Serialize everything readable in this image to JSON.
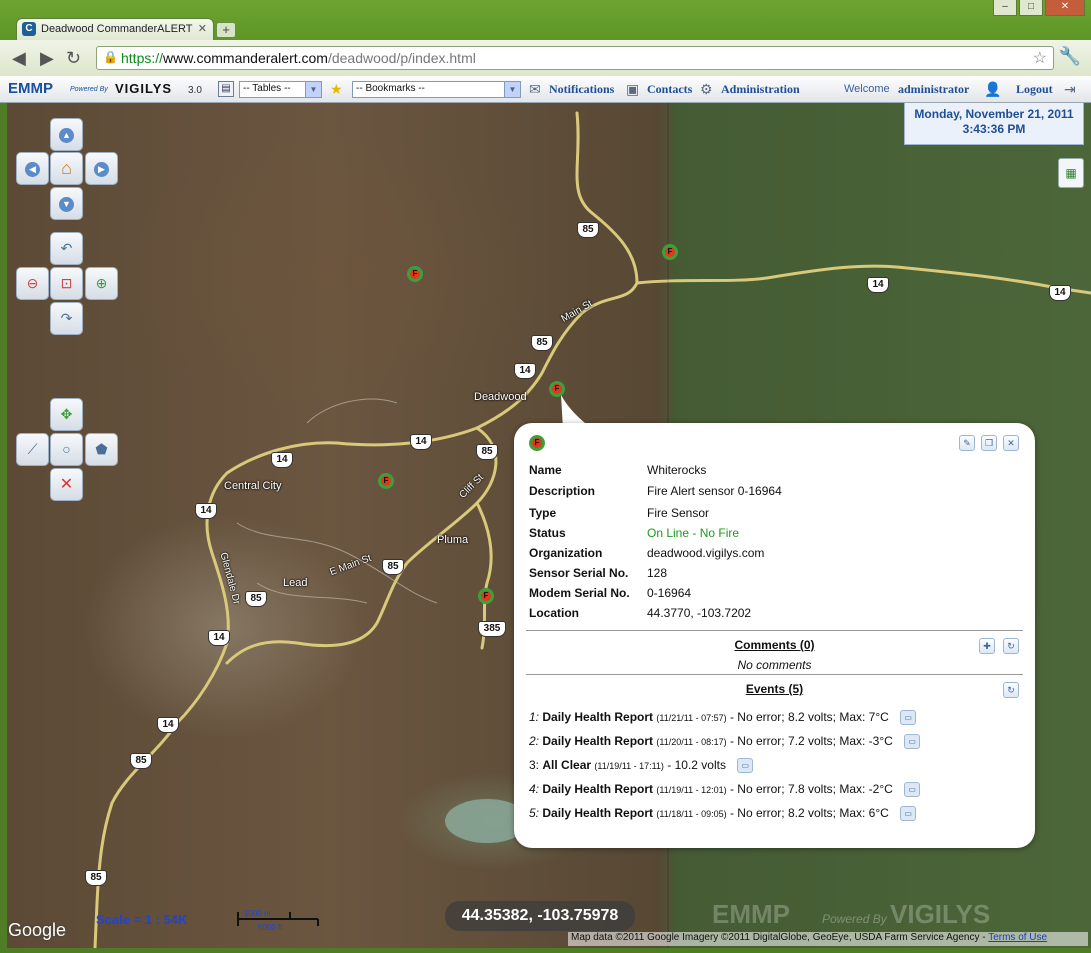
{
  "browser": {
    "tab_title": "Deadwood CommanderALERT",
    "url_scheme": "https://",
    "url_host": "www.commanderalert.com",
    "url_path": "/deadwood/p/index.html"
  },
  "toolbar": {
    "logo": "EMMP",
    "logo_powered": "Powered By",
    "logo_brand": "VIGILYS",
    "version": "3.0",
    "tables_select": "-- Tables --",
    "bookmarks_select": "-- Bookmarks --",
    "notifications": "Notifications",
    "contacts": "Contacts",
    "administration": "Administration",
    "welcome": "Welcome",
    "user": "administrator",
    "logout": "Logout"
  },
  "datetime": {
    "date": "Monday, November 21, 2011",
    "time": "3:43:36 PM"
  },
  "map": {
    "labels": {
      "deadwood": "Deadwood",
      "central_city": "Central City",
      "lead": "Lead",
      "pluma": "Pluma",
      "main_st": "Main St",
      "e_main_st": "E Main St",
      "cliff_st": "Cliff St",
      "glendale_dr": "Glendale Dr"
    },
    "shields": {
      "s85a": "85",
      "s85b": "85",
      "s85c": "85",
      "s85d": "85",
      "s85e": "85",
      "s85f": "85",
      "s85g": "85",
      "s14a": "14",
      "s14b": "14",
      "s14c": "14",
      "s14d": "14",
      "s14e": "14",
      "s14f": "14",
      "s14g": "14",
      "s14h": "14",
      "s385": "385"
    },
    "sensor_glyph": "F",
    "scale": "Scale = 1 : 54K",
    "scale_top": "1000 m",
    "scale_bottom": "5000 ft",
    "coordinates": "44.35382, -103.75978",
    "watermark": "EMMP",
    "watermark_sub": "Powered By",
    "watermark_brand": "VIGILYS",
    "google": "Google",
    "attribution": "Map data ©2011 Google Imagery ©2011 DigitalGlobe, GeoEye, USDA Farm Service Agency -",
    "terms": "Terms of Use"
  },
  "popup": {
    "fields": [
      {
        "key": "Name",
        "value": "Whiterocks"
      },
      {
        "key": "Description",
        "value": "Fire Alert sensor 0-16964"
      },
      {
        "key": "Type",
        "value": "Fire Sensor"
      },
      {
        "key": "Status",
        "value": "On Line - No Fire"
      },
      {
        "key": "Organization",
        "value": "deadwood.vigilys.com"
      },
      {
        "key": "Sensor Serial No.",
        "value": "128"
      },
      {
        "key": "Modem Serial No.",
        "value": "0-16964"
      },
      {
        "key": "Location",
        "value": "44.3770, -103.7202"
      }
    ],
    "status_color": "#1a9a1a",
    "comments_heading": "Comments (0)",
    "no_comments": "No comments",
    "events_heading": "Events (5)",
    "events": [
      {
        "num": "1:",
        "title": "Daily Health Report",
        "when": "(11/21/11 - 07:57)",
        "detail": " - No error; 8.2 volts; Max: 7°C"
      },
      {
        "num": "2:",
        "title": "Daily Health Report",
        "when": "(11/20/11 - 08:17)",
        "detail": " - No error; 7.2 volts; Max: -3°C"
      },
      {
        "num": "3:",
        "title": "All Clear",
        "when": "(11/19/11 - 17:11)",
        "detail": " - 10.2 volts"
      },
      {
        "num": "4:",
        "title": "Daily Health Report",
        "when": "(11/19/11 - 12:01)",
        "detail": " - No error; 7.8 volts; Max: -2°C"
      },
      {
        "num": "5:",
        "title": "Daily Health Report",
        "when": "(11/18/11 - 09:05)",
        "detail": " - No error; 8.2 volts; Max: 6°C"
      }
    ]
  }
}
